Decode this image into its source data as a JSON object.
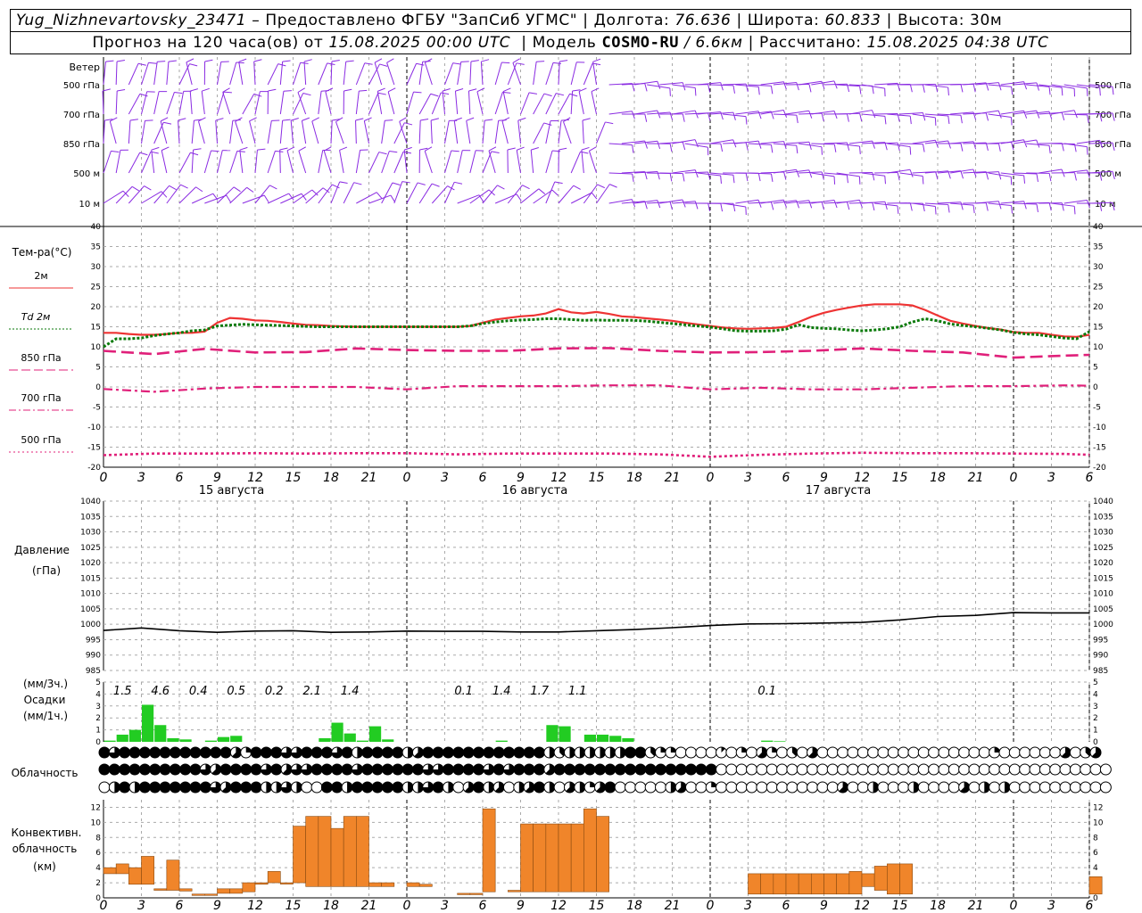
{
  "header": {
    "station": "Yug_Nizhnevartovsky_23471",
    "dash": "–",
    "provided_by": "Предоставлено ФГБУ \"ЗапСиб УГМС\"",
    "lon_label": "Долгота:",
    "lon_value": "76.636",
    "lat_label": "Широта:",
    "lat_value": "60.833",
    "alt_label": "Высота:",
    "alt_value": "30м",
    "forecast_prefix": "Прогноз на 120 часа(ов) от",
    "forecast_time": "15.08.2025 00:00 UTC",
    "model_label": "Модель",
    "model_name": "COSMO-RU",
    "model_res": "/ 6.6км",
    "calc_label": "Рассчитано:",
    "calc_time": "15.08.2025 04:38 UTC",
    "sep": "|"
  },
  "chart_data": [
    {
      "type": "wind-barbs",
      "title": "Ветер",
      "levels": [
        "500 гПа",
        "700 гПа",
        "850 гПа",
        "500 м",
        "10 м"
      ]
    },
    {
      "type": "line",
      "title": "Тем-ра(°C)",
      "ylim": [
        -20,
        40
      ],
      "yticks": [
        -20,
        -15,
        -10,
        -5,
        0,
        5,
        10,
        15,
        20,
        25,
        30,
        35,
        40
      ],
      "x_labels": [
        "0",
        "3",
        "6",
        "9",
        "12",
        "15",
        "18",
        "21",
        "0",
        "3",
        "6",
        "9",
        "12",
        "15",
        "18",
        "21",
        "0",
        "3",
        "6",
        "9",
        "12",
        "15",
        "18",
        "21",
        "0",
        "3",
        "6"
      ],
      "date_labels": [
        "15 августа",
        "16 августа",
        "17 августа"
      ],
      "legend": [
        {
          "name": "2м",
          "color": "#ee3333",
          "style": "solid"
        },
        {
          "name": "Td  2м",
          "color": "#0a7a0a",
          "style": "dotted"
        },
        {
          "name": "850 гПа",
          "color": "#e0207a",
          "style": "dash"
        },
        {
          "name": "700 гПа",
          "color": "#e0207a",
          "style": "dashdot"
        },
        {
          "name": "500 гПа",
          "color": "#e0207a",
          "style": "dot"
        }
      ],
      "series": [
        {
          "name": "2м",
          "x": [
            0,
            1,
            2,
            3,
            4,
            5,
            6,
            7,
            8,
            9,
            10,
            11,
            12,
            13,
            14,
            15,
            16,
            17,
            18,
            19,
            20,
            21,
            22,
            23,
            24,
            25,
            26,
            27,
            28,
            29,
            30,
            31,
            32,
            33,
            34,
            35,
            36,
            37,
            38,
            39,
            40,
            41,
            42,
            43,
            44,
            45,
            46,
            47,
            48,
            49,
            50,
            51,
            52,
            53,
            54,
            55,
            56,
            57,
            58,
            59,
            60,
            61,
            62,
            63,
            64,
            65,
            66,
            67,
            68,
            69,
            70,
            71,
            72,
            73,
            74,
            75,
            76,
            77,
            78
          ],
          "values": [
            13.5,
            13.5,
            13.2,
            13.0,
            13.0,
            13.2,
            13.5,
            13.5,
            13.8,
            16,
            17.2,
            17,
            16.6,
            16.5,
            16.2,
            15.8,
            15.5,
            15.4,
            15.2,
            15.1,
            15.0,
            15.0,
            15.0,
            15.0,
            15.0,
            15.0,
            15.0,
            15.0,
            15.0,
            15.2,
            16.0,
            16.8,
            17.2,
            17.6,
            17.8,
            18.3,
            19.4,
            18.6,
            18.3,
            18.7,
            18.2,
            17.6,
            17.4,
            17.1,
            16.8,
            16.5,
            16.0,
            15.6,
            15.2,
            14.8,
            14.6,
            14.5,
            14.6,
            14.7,
            15.0,
            16.2,
            17.5,
            18.5,
            19.2,
            19.8,
            20.3,
            20.6,
            20.6,
            20.6,
            20.3,
            19.2,
            17.8,
            16.5,
            15.8,
            15.2,
            14.7,
            14.3,
            13.7,
            13.5,
            13.5,
            13.0,
            12.6,
            12.5,
            13.0
          ]
        },
        {
          "name": "Td  2м",
          "x": [
            0,
            1,
            2,
            3,
            4,
            5,
            6,
            7,
            8,
            9,
            10,
            11,
            12,
            13,
            14,
            15,
            16,
            17,
            18,
            19,
            20,
            21,
            22,
            23,
            24,
            25,
            26,
            27,
            28,
            29,
            30,
            31,
            32,
            33,
            34,
            35,
            36,
            37,
            38,
            39,
            40,
            41,
            42,
            43,
            44,
            45,
            46,
            47,
            48,
            49,
            50,
            51,
            52,
            53,
            54,
            55,
            56,
            57,
            58,
            59,
            60,
            61,
            62,
            63,
            64,
            65,
            66,
            67,
            68,
            69,
            70,
            71,
            72,
            73,
            74,
            75,
            76,
            77,
            78
          ],
          "values": [
            10,
            12,
            12,
            12.2,
            12.8,
            13.2,
            13.5,
            14,
            14.2,
            15.2,
            15.4,
            15.6,
            15.5,
            15.4,
            15.3,
            15.2,
            15.1,
            15.0,
            15.0,
            15.0,
            15.0,
            15.0,
            15.0,
            15.0,
            15.0,
            15.0,
            15.0,
            15.0,
            15.0,
            15.2,
            15.8,
            16.2,
            16.5,
            16.7,
            16.8,
            17.0,
            17.0,
            16.8,
            16.6,
            16.7,
            16.6,
            16.6,
            16.6,
            16.4,
            16.1,
            15.8,
            15.5,
            15.2,
            14.9,
            14.5,
            14.0,
            13.9,
            13.9,
            14.0,
            14.4,
            15.5,
            14.8,
            14.6,
            14.5,
            14.2,
            14.0,
            14.2,
            14.5,
            15.0,
            16.2,
            17.0,
            16.5,
            15.7,
            15.3,
            15.0,
            14.6,
            14.2,
            13.6,
            13.2,
            13.0,
            12.6,
            12.2,
            12.0,
            13.8
          ]
        },
        {
          "name": "850 гПа",
          "x": [
            0,
            4,
            8,
            12,
            16,
            20,
            24,
            28,
            32,
            36,
            40,
            44,
            48,
            52,
            56,
            60,
            64,
            68,
            72,
            76,
            78
          ],
          "values": [
            9,
            8.2,
            9.5,
            8.6,
            8.7,
            9.6,
            9.2,
            9.0,
            9.0,
            9.6,
            9.7,
            9.0,
            8.6,
            8.7,
            9.0,
            9.6,
            9.0,
            8.6,
            7.3,
            7.8,
            8.0
          ]
        },
        {
          "name": "700 гПа",
          "x": [
            0,
            4,
            8,
            12,
            16,
            20,
            24,
            28,
            32,
            36,
            40,
            44,
            48,
            52,
            56,
            60,
            64,
            68,
            72,
            76,
            78
          ],
          "values": [
            -0.5,
            -1.2,
            -0.4,
            0.0,
            0.0,
            0.0,
            -0.6,
            0.2,
            0.2,
            0.2,
            0.4,
            0.4,
            -0.6,
            -0.2,
            -0.6,
            -0.6,
            -0.2,
            0.2,
            0.2,
            0.4,
            0.3
          ]
        },
        {
          "name": "500 гПа",
          "x": [
            0,
            4,
            8,
            12,
            16,
            20,
            24,
            28,
            32,
            36,
            40,
            44,
            48,
            52,
            56,
            60,
            64,
            68,
            72,
            76,
            78
          ],
          "values": [
            -17.0,
            -16.6,
            -16.6,
            -16.5,
            -16.6,
            -16.5,
            -16.5,
            -16.8,
            -16.6,
            -16.6,
            -16.6,
            -16.8,
            -17.4,
            -16.9,
            -16.6,
            -16.4,
            -16.5,
            -16.5,
            -16.6,
            -16.7,
            -16.9
          ]
        }
      ]
    },
    {
      "type": "line",
      "title": "Давление",
      "ylabel": "(гПа)",
      "ylim": [
        985,
        1040
      ],
      "yticks": [
        985,
        990,
        995,
        1000,
        1005,
        1010,
        1015,
        1020,
        1025,
        1030,
        1035,
        1040
      ],
      "x_labels": [
        "0",
        "3",
        "6",
        "9",
        "12",
        "15",
        "18",
        "21",
        "0",
        "3",
        "6",
        "9",
        "12",
        "15",
        "18",
        "21",
        "0",
        "3",
        "6",
        "9",
        "12",
        "15",
        "18",
        "21",
        "0",
        "3",
        "6"
      ],
      "series": [
        {
          "name": "Давление",
          "x": [
            0,
            3,
            6,
            9,
            12,
            15,
            18,
            21,
            24,
            27,
            30,
            33,
            36,
            39,
            42,
            45,
            48,
            51,
            54,
            57,
            60,
            63,
            66,
            69,
            72,
            75,
            78
          ],
          "values": [
            998,
            998.8,
            997.9,
            997.4,
            997.8,
            997.9,
            997.4,
            997.5,
            997.8,
            997.7,
            997.7,
            997.5,
            997.5,
            997.9,
            998.3,
            998.9,
            999.6,
            1000.1,
            1000.2,
            1000.4,
            1000.6,
            1001.4,
            1002.5,
            1002.9,
            1003.8,
            1003.7,
            1003.7
          ]
        }
      ]
    },
    {
      "type": "bar",
      "title": "Осадки",
      "ylabel": "(мм/3ч.)",
      "ylabel2": "(мм/1ч.)",
      "ylim": [
        0,
        5
      ],
      "yticks": [
        0,
        1,
        2,
        3,
        4,
        5
      ],
      "totals_3h": [
        {
          "x": 1.5,
          "label": "1.5"
        },
        {
          "x": 4.5,
          "label": "4.6"
        },
        {
          "x": 7.5,
          "label": "0.4"
        },
        {
          "x": 10.5,
          "label": "0.5"
        },
        {
          "x": 13.5,
          "label": "0.2"
        },
        {
          "x": 16.5,
          "label": "2.1"
        },
        {
          "x": 19.5,
          "label": "1.4"
        },
        {
          "x": 28.5,
          "label": "0.1"
        },
        {
          "x": 31.5,
          "label": "1.4"
        },
        {
          "x": 34.5,
          "label": "1.7"
        },
        {
          "x": 37.5,
          "label": "1.1"
        },
        {
          "x": 52.5,
          "label": "0.1"
        }
      ],
      "hourly_x": [
        0,
        1,
        2,
        3,
        4,
        5,
        6,
        7,
        8,
        9,
        10,
        11,
        12,
        13,
        14,
        15,
        16,
        17,
        18,
        19,
        20,
        21,
        22,
        23,
        24,
        25,
        26,
        27,
        28,
        29,
        30,
        31,
        32,
        33,
        34,
        35,
        36,
        37,
        38,
        39,
        40,
        41,
        42,
        43,
        44,
        45,
        46,
        47,
        48,
        49,
        50,
        51,
        52,
        53,
        54,
        55
      ],
      "hourly_values": [
        0.1,
        0.6,
        1.0,
        3.1,
        1.4,
        0.3,
        0.2,
        0,
        0.1,
        0.4,
        0.5,
        0,
        0,
        0,
        0,
        0,
        0,
        0.3,
        1.6,
        0.7,
        0.1,
        1.3,
        0.2,
        0,
        0,
        0,
        0,
        0,
        0,
        0,
        0,
        0.1,
        0,
        0,
        0,
        1.4,
        1.3,
        0,
        0.6,
        0.6,
        0.5,
        0.3,
        0,
        0,
        0,
        0,
        0,
        0,
        0,
        0,
        0,
        0,
        0.1,
        0.05,
        0,
        0
      ]
    },
    {
      "type": "table",
      "title": "Облачность",
      "note": "rows: high, middle, low; cover 0-8 octas",
      "rows": [
        "8,6,8,8,8,8,8,8,8,8,8,8,8,5,2,8,8,8,6,6,8,8,8,6,8,4,8,8,8,8,4,5,8,8,8,8,8,8,8,8,8,8,8,8,4,3,4,4,4,4,4,4,8,8,3,2,2,0,0,0,0,1,0,2,0,5,2,0,3,0,5,0,0,0,0,0,0,0,0,0,0,0,0,0,0,0,0,0,2,0,0,0,0,0,0,5,0,3,5",
        "8,8,8,8,8,8,8,8,8,8,6,5,8,8,8,8,6,8,5,6,6,8,8,8,8,6,8,8,8,8,8,8,6,6,8,8,8,8,6,8,6,8,8,8,5,8,8,8,8,8,8,8,8,8,8,8,8,8,8,8,8,0,0,0,0,0,0,0,0,0,0,0,0,0,0,0,0,0,0,0,0,0,0,0,0,0,0,0,0,0,0,0,0,0,0,0,0,0,0,0",
        "0,4,8,4,8,8,8,8,8,8,8,6,5,8,8,8,4,4,6,4,0,0,8,8,4,8,8,8,8,8,4,4,6,8,4,0,5,8,4,5,0,4,5,8,4,0,5,4,2,5,8,0,0,0,0,0,4,5,0,0,2,0,0,0,0,0,0,0,0,0,0,0,0,5,0,0,4,0,0,0,4,0,0,0,0,5,0,4,0,4,0,0,0,0,0,0,0,0,0,0"
      ]
    },
    {
      "type": "bar",
      "title": "Конвективн.",
      "title2": "облачность",
      "ylabel": "(км)",
      "ylim": [
        0,
        13
      ],
      "yticks": [
        0,
        2,
        4,
        6,
        8,
        10,
        12
      ],
      "bars": [
        {
          "x": 0,
          "lo": 3.2,
          "hi": 4.0
        },
        {
          "x": 1,
          "lo": 3.2,
          "hi": 4.5
        },
        {
          "x": 2,
          "lo": 1.8,
          "hi": 4.0
        },
        {
          "x": 3,
          "lo": 1.8,
          "hi": 5.5
        },
        {
          "x": 4,
          "lo": 1.0,
          "hi": 1.2
        },
        {
          "x": 5,
          "lo": 1.0,
          "hi": 5.0
        },
        {
          "x": 6,
          "lo": 0.9,
          "hi": 1.2
        },
        {
          "x": 7,
          "lo": 0.5,
          "hi": 0.5
        },
        {
          "x": 8,
          "lo": 0.5,
          "hi": 0.5
        },
        {
          "x": 9,
          "lo": 0.6,
          "hi": 1.2
        },
        {
          "x": 10,
          "lo": 0.6,
          "hi": 1.2
        },
        {
          "x": 11,
          "lo": 0.8,
          "hi": 2.0
        },
        {
          "x": 12,
          "lo": 1.8,
          "hi": 2.0
        },
        {
          "x": 13,
          "lo": 2.0,
          "hi": 3.5
        },
        {
          "x": 14,
          "lo": 2.0,
          "hi": 2.0
        },
        {
          "x": 15,
          "lo": 2.0,
          "hi": 9.5
        },
        {
          "x": 16,
          "lo": 1.5,
          "hi": 10.8
        },
        {
          "x": 17,
          "lo": 1.5,
          "hi": 10.8
        },
        {
          "x": 18,
          "lo": 1.5,
          "hi": 9.2
        },
        {
          "x": 19,
          "lo": 1.5,
          "hi": 10.8
        },
        {
          "x": 20,
          "lo": 1.5,
          "hi": 10.8
        },
        {
          "x": 21,
          "lo": 1.5,
          "hi": 2.0
        },
        {
          "x": 22,
          "lo": 1.5,
          "hi": 2.0
        },
        {
          "x": 24,
          "lo": 1.5,
          "hi": 2.0
        },
        {
          "x": 25,
          "lo": 1.5,
          "hi": 1.8
        },
        {
          "x": 28,
          "lo": 0.6,
          "hi": 0.6
        },
        {
          "x": 29,
          "lo": 0.6,
          "hi": 0.6
        },
        {
          "x": 30,
          "lo": 0.8,
          "hi": 11.8
        },
        {
          "x": 32,
          "lo": 0.8,
          "hi": 1.0
        },
        {
          "x": 33,
          "lo": 0.8,
          "hi": 9.8
        },
        {
          "x": 34,
          "lo": 0.8,
          "hi": 9.8
        },
        {
          "x": 35,
          "lo": 0.8,
          "hi": 9.8
        },
        {
          "x": 36,
          "lo": 0.8,
          "hi": 9.8
        },
        {
          "x": 37,
          "lo": 0.8,
          "hi": 9.8
        },
        {
          "x": 38,
          "lo": 0.8,
          "hi": 11.8
        },
        {
          "x": 39,
          "lo": 0.8,
          "hi": 10.8
        },
        {
          "x": 51,
          "lo": 0.5,
          "hi": 3.2
        },
        {
          "x": 52,
          "lo": 0.5,
          "hi": 3.2
        },
        {
          "x": 53,
          "lo": 0.5,
          "hi": 3.2
        },
        {
          "x": 54,
          "lo": 0.5,
          "hi": 3.2
        },
        {
          "x": 55,
          "lo": 0.5,
          "hi": 3.2
        },
        {
          "x": 56,
          "lo": 0.5,
          "hi": 3.2
        },
        {
          "x": 57,
          "lo": 0.5,
          "hi": 3.2
        },
        {
          "x": 58,
          "lo": 0.5,
          "hi": 3.2
        },
        {
          "x": 59,
          "lo": 0.5,
          "hi": 3.5
        },
        {
          "x": 60,
          "lo": 1.5,
          "hi": 3.2
        },
        {
          "x": 61,
          "lo": 1.0,
          "hi": 4.2
        },
        {
          "x": 62,
          "lo": 0.5,
          "hi": 4.5
        },
        {
          "x": 63,
          "lo": 0.5,
          "hi": 4.5
        },
        {
          "x": 78,
          "lo": 0.5,
          "hi": 2.8
        }
      ]
    }
  ],
  "colors": {
    "wind": "#8a2be2",
    "temp": "#ee3333",
    "dew": "#0a7a0a",
    "upper": "#e0207a",
    "precip": "#22cc22",
    "conv": "#f0852a",
    "grid": "#aaaaaa"
  }
}
